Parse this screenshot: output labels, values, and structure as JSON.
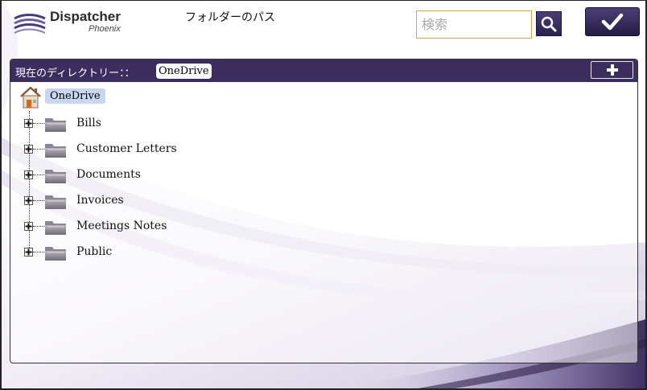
{
  "header": {
    "app_name": "Dispatcher",
    "app_subtitle": "Phoenix",
    "page_title": "フォルダーのパス",
    "search_placeholder": "検索",
    "search_value": "",
    "search_icon": "magnifier-icon",
    "ok_icon": "checkmark-icon"
  },
  "panel": {
    "current_dir_label": "現在のディレクトリー：：",
    "current_dir_value": "OneDrive",
    "add_icon": "plus-icon"
  },
  "tree": {
    "root": {
      "label": "OneDrive",
      "icon": "home-icon"
    },
    "folders": [
      {
        "label": "Bills",
        "icon": "folder-icon",
        "expander": "plus"
      },
      {
        "label": "Customer Letters",
        "icon": "folder-icon",
        "expander": "plus"
      },
      {
        "label": "Documents",
        "icon": "folder-icon",
        "expander": "plus"
      },
      {
        "label": "Invoices",
        "icon": "folder-icon",
        "expander": "plus"
      },
      {
        "label": "Meetings Notes",
        "icon": "folder-icon",
        "expander": "plus"
      },
      {
        "label": "Public",
        "icon": "folder-icon",
        "expander": "plus"
      }
    ]
  },
  "colors": {
    "accent_purple": "#3b2d5e",
    "search_border": "#d9a441",
    "root_highlight": "#c8d6ef"
  }
}
